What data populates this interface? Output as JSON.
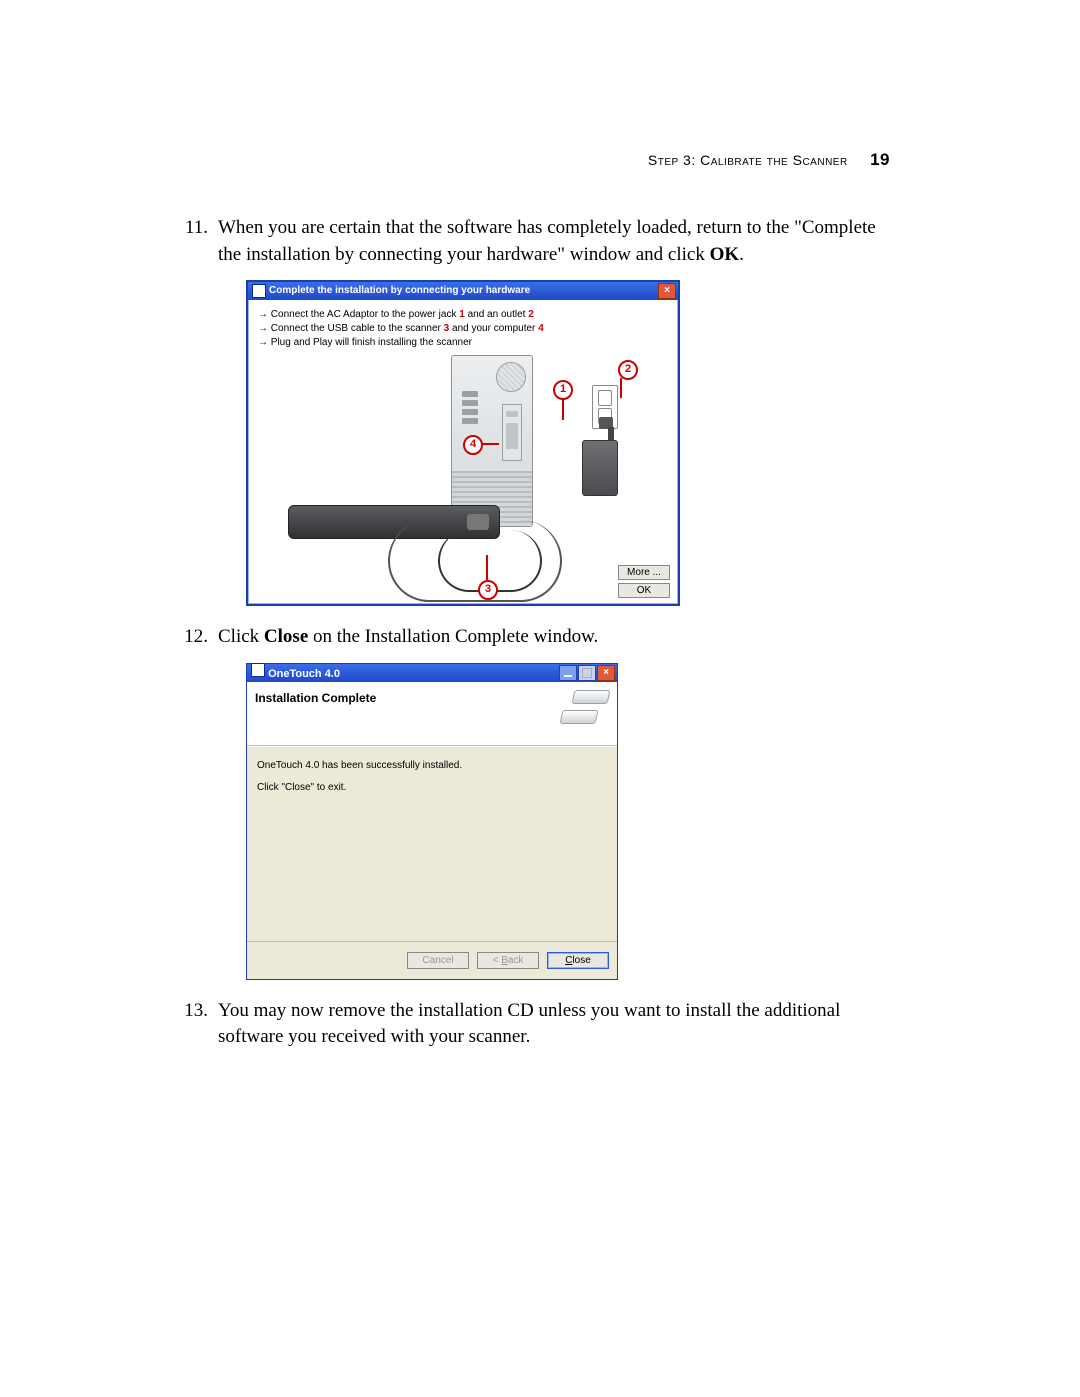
{
  "header": {
    "section_label": "Step 3: Calibrate the Scanner",
    "page_number": "19"
  },
  "steps": [
    {
      "number": "11.",
      "text_a": "When you are certain that the software has completely loaded, return to the \"Complete the installation by connecting your hardware\" window and click ",
      "bold": "OK",
      "text_b": "."
    },
    {
      "number": "12.",
      "text_a": "Click ",
      "bold": "Close",
      "text_b": " on the Installation Complete window."
    },
    {
      "number": "13.",
      "text_a": "You may now remove the installation CD unless you want to install the additional software you received with your scanner.",
      "bold": "",
      "text_b": ""
    }
  ],
  "dialog1": {
    "title": "Complete the installation by connecting your hardware",
    "bullets": {
      "b1a": "Connect the AC Adaptor to the power jack ",
      "b1n1": "1",
      "b1b": " and an outlet ",
      "b1n2": "2",
      "b2a": "Connect the USB cable to the scanner ",
      "b2n1": "3",
      "b2b": " and your computer ",
      "b2n2": "4",
      "b3": "Plug and Play will finish installing the scanner"
    },
    "callouts": {
      "c1": "1",
      "c2": "2",
      "c3": "3",
      "c4": "4"
    },
    "buttons": {
      "more": "More ...",
      "ok": "OK"
    }
  },
  "dialog2": {
    "title": "OneTouch 4.0",
    "heading": "Installation Complete",
    "line1": "OneTouch 4.0 has been successfully installed.",
    "line2": "Click \"Close\" to exit.",
    "buttons": {
      "cancel": "Cancel",
      "back_prefix": "< ",
      "back_u": "B",
      "back_rest": "ack",
      "close_u": "C",
      "close_rest": "lose"
    }
  }
}
